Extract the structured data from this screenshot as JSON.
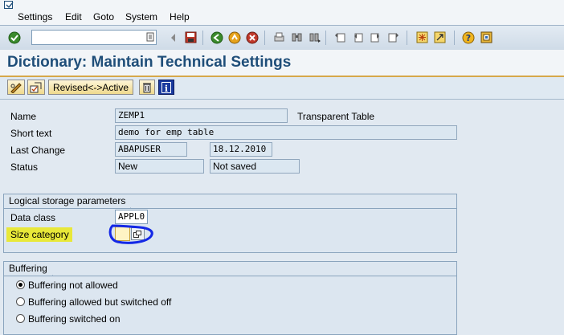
{
  "menu": {
    "items": [
      "Settings",
      "Edit",
      "Goto",
      "System",
      "Help"
    ]
  },
  "toolbar": {
    "command_value": "",
    "icons": [
      "enter-icon",
      "back-icon",
      "save-icon",
      "back-nav-icon",
      "exit-icon",
      "cancel-icon",
      "print-icon",
      "find-icon",
      "find-next-icon",
      "first-page-icon",
      "previous-page-icon",
      "next-page-icon",
      "last-page-icon",
      "create-session-icon",
      "shortcut-icon",
      "help-icon",
      "layout-icon"
    ]
  },
  "title": "Dictionary: Maintain Technical Settings",
  "app_toolbar": {
    "revised_active_label": "Revised<->Active"
  },
  "header": {
    "name_label": "Name",
    "name_value": "ZEMP1",
    "table_type": "Transparent Table",
    "short_text_label": "Short text",
    "short_text_value": "demo for emp table",
    "last_change_label": "Last Change",
    "last_change_user": "ABAPUSER",
    "last_change_date": "18.12.2010",
    "status_label": "Status",
    "status_value": "New",
    "status_save": "Not saved"
  },
  "logical_storage": {
    "title": "Logical storage parameters",
    "data_class_label": "Data class",
    "data_class_value": "APPL0",
    "size_category_label": "Size category",
    "size_category_value": ""
  },
  "buffering": {
    "title": "Buffering",
    "options": [
      {
        "label": "Buffering not allowed",
        "selected": true
      },
      {
        "label": "Buffering allowed but switched off",
        "selected": false
      },
      {
        "label": "Buffering switched on",
        "selected": false
      }
    ]
  },
  "colors": {
    "title_text": "#1f4e79",
    "highlight": "#e8e839",
    "annotation": "#1428e6"
  }
}
